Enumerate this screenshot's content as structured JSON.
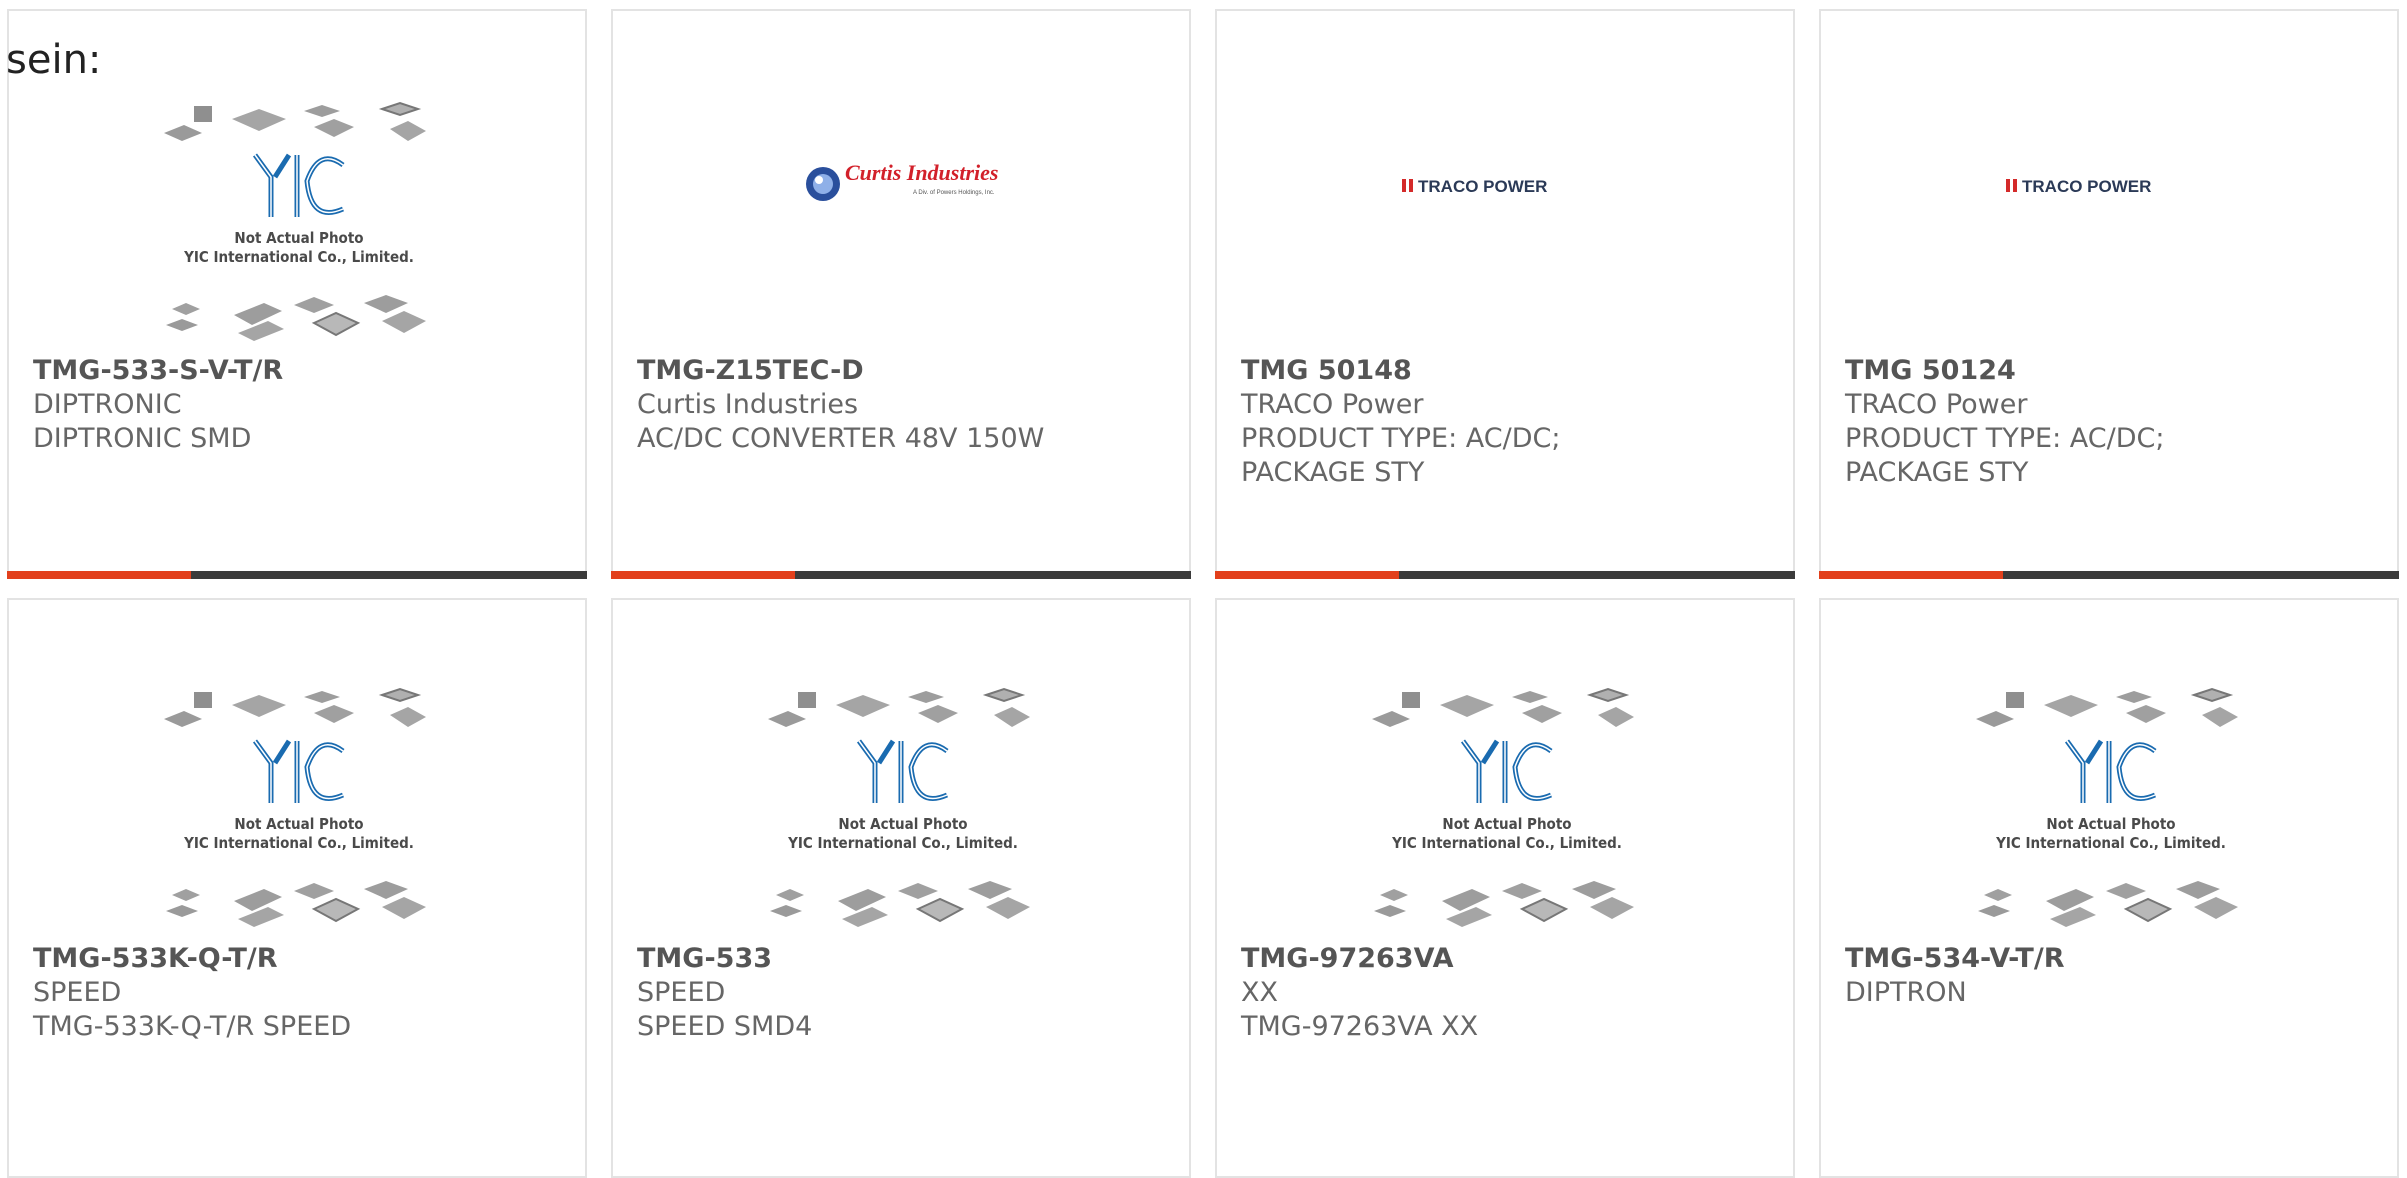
{
  "page_label": "sein:",
  "placeholder_caption": [
    "Not Actual Photo",
    "YIC International Co., Limited."
  ],
  "brand_logos": {
    "curtis_name": "Curtis Industries",
    "curtis_tagline": "A Div. of Powers Holdings, Inc.",
    "traco_name": "TRACO POWER"
  },
  "colors": {
    "accent_bar": "#e2401c",
    "dark_bar": "#3b3b3b",
    "yic_blue": "#1a6bb0",
    "traco_red": "#d42a2a"
  },
  "cards": [
    {
      "image": "yic-placeholder",
      "part_no": "TMG-533-S-V-T/R",
      "lines": [
        "DIPTRONIC",
        "DIPTRONIC SMD"
      ]
    },
    {
      "image": "curtis-logo",
      "part_no": "TMG-Z15TEC-D",
      "lines": [
        "Curtis Industries",
        "AC/DC CONVERTER 48V 150W"
      ]
    },
    {
      "image": "traco-logo",
      "part_no": "TMG 50148",
      "lines": [
        "TRACO Power",
        "PRODUCT TYPE: AC/DC;",
        "PACKAGE STY"
      ]
    },
    {
      "image": "traco-logo",
      "part_no": "TMG 50124",
      "lines": [
        "TRACO Power",
        "PRODUCT TYPE: AC/DC;",
        "PACKAGE STY"
      ]
    },
    {
      "image": "yic-placeholder",
      "part_no": "TMG-533K-Q-T/R",
      "lines": [
        "SPEED",
        "TMG-533K-Q-T/R SPEED"
      ]
    },
    {
      "image": "yic-placeholder",
      "part_no": "TMG-533",
      "lines": [
        "SPEED",
        "SPEED SMD4"
      ]
    },
    {
      "image": "yic-placeholder",
      "part_no": "TMG-97263VA",
      "lines": [
        "XX",
        "TMG-97263VA XX"
      ]
    },
    {
      "image": "yic-placeholder",
      "part_no": "TMG-534-V-T/R",
      "lines": [
        "DIPTRON"
      ]
    }
  ]
}
